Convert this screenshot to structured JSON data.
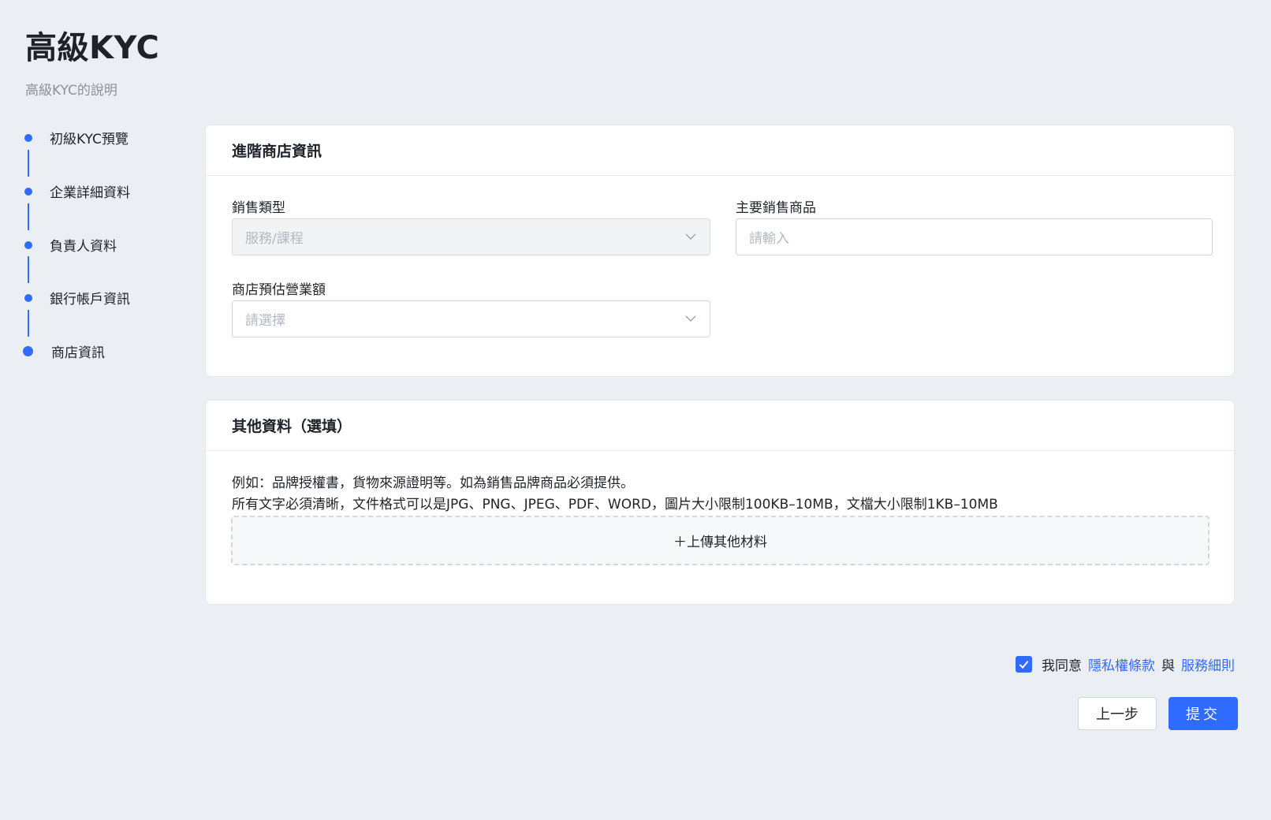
{
  "header": {
    "title": "高級KYC",
    "subtitle": "高級KYC的說明"
  },
  "steps": [
    {
      "label": "初級KYC預覽"
    },
    {
      "label": "企業詳細資料"
    },
    {
      "label": "負責人資料"
    },
    {
      "label": "銀行帳戶資訊"
    },
    {
      "label": "商店資訊"
    }
  ],
  "store_section": {
    "title": "進階商店資訊",
    "sales_type": {
      "label": "銷售類型",
      "value": "服務/課程"
    },
    "main_products": {
      "label": "主要銷售商品",
      "placeholder": "請輸入"
    },
    "revenue": {
      "label": "商店預估營業額",
      "placeholder": "請選擇"
    }
  },
  "other_section": {
    "title": "其他資料（選填）",
    "desc_line1": "例如：品牌授權書，貨物來源證明等。如為銷售品牌商品必須提供。",
    "desc_line2": "所有文字必須清晰，文件格式可以是JPG、PNG、JPEG、PDF、WORD，圖片大小限制100KB–10MB，文檔大小限制1KB–10MB",
    "upload_label": "＋上傳其他材料"
  },
  "agreement": {
    "prefix": "我同意",
    "privacy_link": "隱私權條款",
    "connector": "與",
    "terms_link": "服務細則",
    "checked": true
  },
  "actions": {
    "prev_label": "上一步",
    "submit_label": "提交"
  },
  "colors": {
    "accent": "#2f6bff",
    "background": "#ebeef3"
  }
}
